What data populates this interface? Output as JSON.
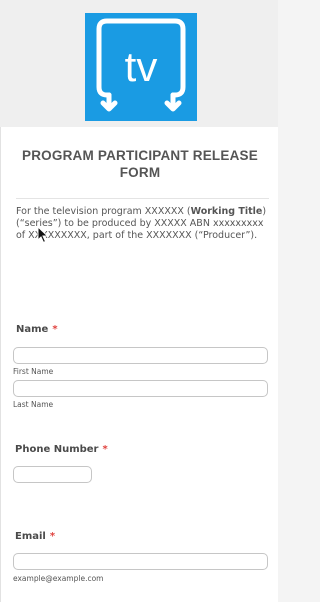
{
  "logo": {
    "text": "tv",
    "icon": "tv-logo-icon",
    "color": "#1a9be3"
  },
  "form": {
    "title": "PROGRAM PARTICIPANT RELEASE FORM",
    "intro": {
      "part1": "For the television program XXXXXX (",
      "bold": "Working Title",
      "part2": ") (“series”) to be produced by XXXXX ABN xxxxxxxxx of XXXXXXXXX, part of the XXXXXXX (“Producer”)."
    },
    "fields": {
      "name": {
        "label": "Name",
        "required_mark": "*",
        "first_value": "",
        "first_sublabel": "First Name",
        "last_value": "",
        "last_sublabel": "Last Name"
      },
      "phone": {
        "label": "Phone Number",
        "required_mark": "*",
        "value": ""
      },
      "email": {
        "label": "Email",
        "required_mark": "*",
        "value": "",
        "sublabel": "example@example.com"
      }
    }
  },
  "colors": {
    "required": "#e0433f",
    "text": "#4a4a4a",
    "input_border": "#c6c6c6"
  }
}
